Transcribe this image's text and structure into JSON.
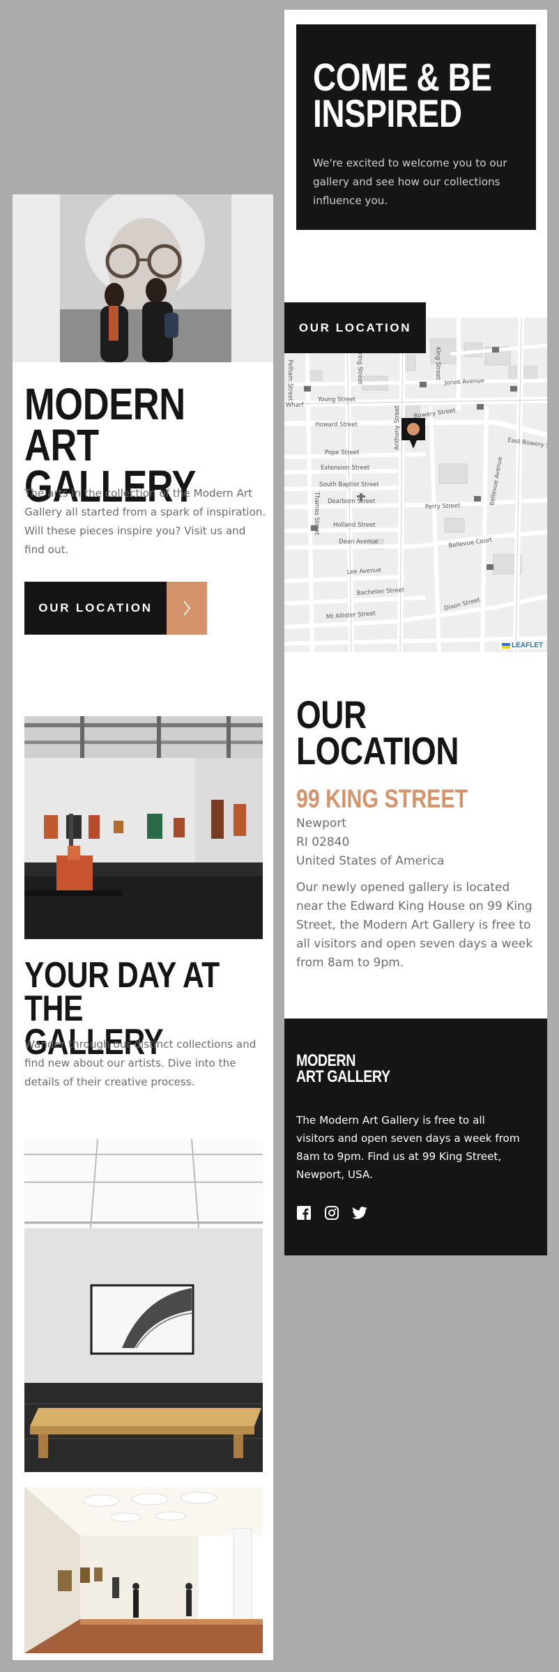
{
  "home": {
    "hero_title": "Modern\nArt Gallery",
    "hero_text": "The arts in the collection of the Modern Art Gallery all started from a spark of inspiration. Will these pieces inspire you? Visit us and find out.",
    "location_button": "Our Location",
    "day_title": "Your day at the gallery",
    "day_text": "Wander through our distinct collections and find new about our artists. Dive into the details of their creative process."
  },
  "location_page": {
    "inspire_title": "Come & Be\nInspired",
    "inspire_text": "We're excited to welcome you to our gallery and see how our collections influence you.",
    "map_button": "Our Location",
    "map_attribution": "Leaflet",
    "map_streets": [
      "Spring Street",
      "King Street",
      "Jones Avenue",
      "Young Street",
      "Bowery Street",
      "Howard Street",
      "East Bowery St",
      "Pope Street",
      "Extension Street",
      "South Baptist Street",
      "Dearborn Street",
      "Perry Street",
      "Holland Street",
      "Dean Avenue",
      "Bellevue Court",
      "Bellevue Avenue",
      "Lee Avenue",
      "Bachelier Street",
      "Mt Allister Street",
      "Dixon Street",
      "Thames Street",
      "Anthony Street",
      "Wharf",
      "Pelham Street"
    ],
    "location_title": "Our\nLocation",
    "street": "99 King Street",
    "address_lines": [
      "Newport",
      "RI 02840",
      "United States of America"
    ],
    "location_text": "Our newly opened gallery is located near the Edward King House on 99 King Street, the Modern Art Gallery is free to all visitors and open seven days a week from 8am to 9pm.",
    "footer_logo": "Modern\nArt Gallery",
    "footer_text": "The Modern Art Gallery is free to all visitors and open seven days a week from 8am to 9pm. Find us at 99 King Street, Newport, USA.",
    "socials": [
      "facebook-icon",
      "instagram-icon",
      "twitter-icon"
    ]
  },
  "colors": {
    "accent": "#d5936c",
    "dark": "#151515",
    "background": "#ababab",
    "text_muted": "#6c6c6c"
  }
}
